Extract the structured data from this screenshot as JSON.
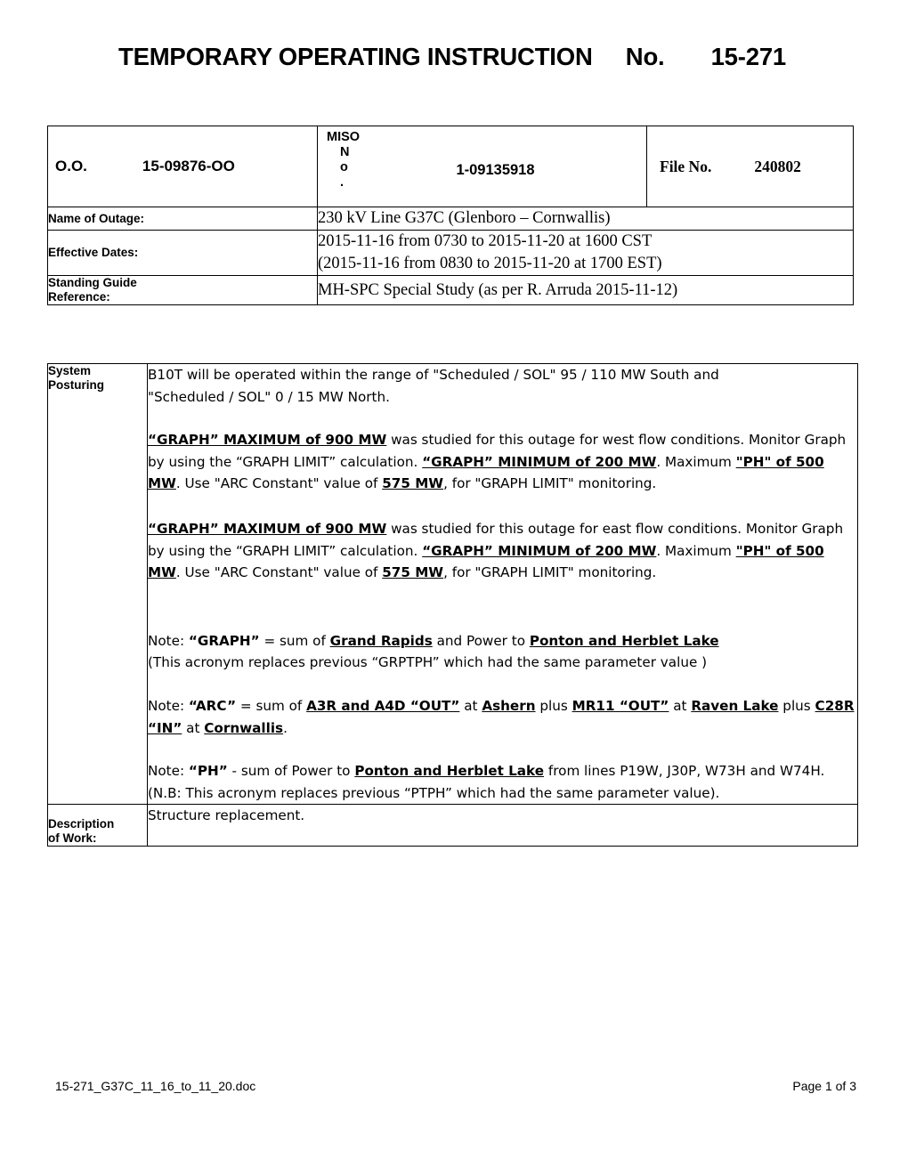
{
  "document": {
    "title": "TEMPORARY OPERATING INSTRUCTION     No.       15-271"
  },
  "header": {
    "oo_label": "O.O.",
    "oo_value": "15-09876-OO",
    "miso_line1": "MISO",
    "miso_line2": "N",
    "miso_line3": "o",
    "miso_line4": ".",
    "miso_value": "1-09135918",
    "file_label": "File No.",
    "file_value": "240802",
    "rows": [
      {
        "label": "Name of Outage:",
        "value": "230 kV Line G37C (Glenboro – Cornwallis)"
      },
      {
        "label": "Effective Dates:",
        "line1": "2015-11-16 from 0730 to 2015-11-20 at 1600 CST",
        "line2": "(2015-11-16 from 0830 to 2015-11-20 at 1700 EST)"
      },
      {
        "label_line1": "Standing Guide",
        "label_line2": "Reference:",
        "value": "MH-SPC Special Study (as per R. Arruda 2015-11-12)"
      }
    ]
  },
  "body": {
    "posturing_label_line1": "System",
    "posturing_label_line2": "Posturing",
    "posturing": {
      "p1_line1": "B10T will be operated within the range of \"Scheduled / SOL\"  95 / 110 MW South and",
      "p1_line2": "\"Scheduled / SOL\"  0 / 15  MW North.",
      "west": {
        "bold1": "“GRAPH” MAXIMUM of  900 MW",
        "text1": " was studied for this outage for west flow conditions. Monitor Graph by using the “GRAPH LIMIT” calculation. ",
        "bold2": "“GRAPH” MINIMUM of  200 MW",
        "text2": ". Maximum ",
        "bold3": "\"PH\" of 500 MW",
        "text3": ". Use \"ARC Constant\" value of ",
        "bold4": "575 MW",
        "text4": ", for \"GRAPH LIMIT\" monitoring."
      },
      "east": {
        "bold1": "“GRAPH” MAXIMUM of  900 MW",
        "text1": " was studied for this outage for east flow conditions. Monitor Graph by using the “GRAPH LIMIT” calculation. ",
        "bold2": "“GRAPH” MINIMUM of  200 MW",
        "text2": ". Maximum ",
        "bold3": "\"PH\" of 500 MW",
        "text3": ". Use \"ARC Constant\" value of ",
        "bold4": "575 MW",
        "text4": ", for \"GRAPH LIMIT\" monitoring."
      },
      "note_graph": {
        "lead": "Note: ",
        "term": "“GRAPH”",
        "mid1": " = sum of ",
        "ref1": "Grand Rapids",
        "mid2": " and Power to ",
        "ref2": "Ponton and Herblet Lake ",
        "line2": "(This acronym replaces previous “GRPTPH” which had the same parameter value )"
      },
      "note_arc": {
        "lead": "Note:  ",
        "term": "“ARC”",
        "mid1": " =  sum of ",
        "ref1": "A3R and A4D “OUT”",
        "mid2": " at ",
        "ref2": "Ashern",
        "mid3": " plus ",
        "ref3": "MR11 “OUT”",
        "mid4": " at ",
        "ref4": "Raven Lake",
        "mid5": " plus ",
        "ref5": "C28R “IN”",
        "mid6": " at ",
        "ref6": "Cornwallis",
        "tail": "."
      },
      "note_ph": {
        "lead": "Note:  ",
        "term": "“PH”",
        "mid1": " - sum of Power to ",
        "ref1": "Ponton and Herblet Lake",
        "mid2": " from lines P19W, J30P, W73H and W74H.  (N.B: This acronym replaces previous “PTPH” which had the same parameter value)."
      }
    },
    "description_label_line1": "Description",
    "description_label_line2": "of Work:",
    "description_value": "Structure replacement."
  },
  "footer": {
    "filename": "15-271_G37C_11_16_to_11_20.doc",
    "page": "Page 1 of 3"
  }
}
